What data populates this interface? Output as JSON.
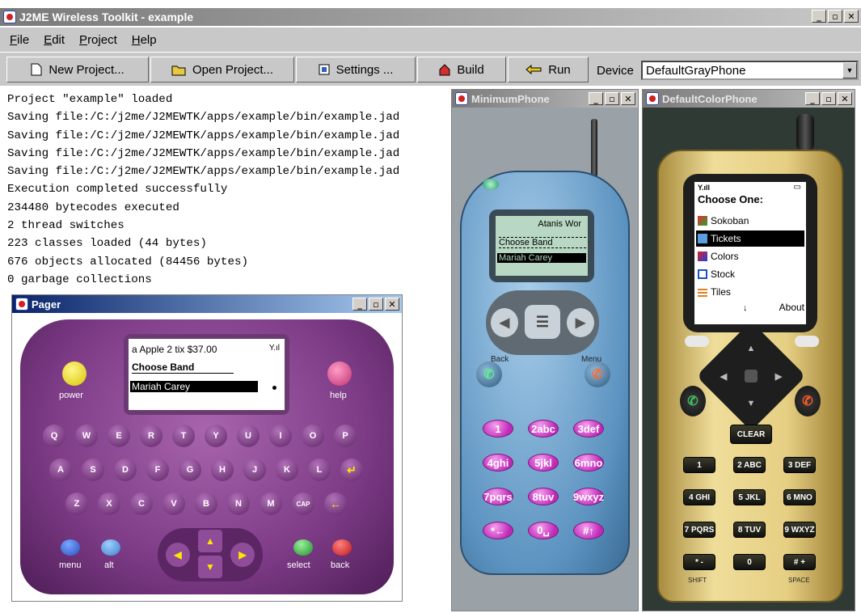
{
  "window": {
    "title": "J2ME Wireless Toolkit - example",
    "controls": [
      "_",
      "▫",
      "✕"
    ]
  },
  "menu": {
    "items": [
      "File",
      "Edit",
      "Project",
      "Help"
    ]
  },
  "toolbar": {
    "new_project": "New Project...",
    "open_project": "Open Project...",
    "settings": "Settings ...",
    "build": "Build",
    "run": "Run",
    "device_label": "Device",
    "device_value": "DefaultGrayPhone"
  },
  "console": {
    "lines": [
      "Project \"example\" loaded",
      "Saving file:/C:/j2me/J2MEWTK/apps/example/bin/example.jad",
      "Saving file:/C:/j2me/J2MEWTK/apps/example/bin/example.jad",
      "Saving file:/C:/j2me/J2MEWTK/apps/example/bin/example.jad",
      "Saving file:/C:/j2me/J2MEWTK/apps/example/bin/example.jad",
      "Execution completed successfully",
      "234480 bytecodes executed",
      "2 thread switches",
      "223 classes loaded (44 bytes)",
      "676 objects allocated (84456 bytes)",
      "0 garbage collections"
    ]
  },
  "pager": {
    "title": "Pager",
    "screen": {
      "line1": "a Apple 2 tix $37.00",
      "line2": "Choose Band",
      "line3": "Mariah Carey",
      "signal": "Y.ıl"
    },
    "buttons": {
      "power": "power",
      "help": "help",
      "menu": "menu",
      "alt": "alt",
      "select": "select",
      "back": "back",
      "cap": "CAP"
    },
    "rows": [
      [
        "Q",
        "W",
        "E",
        "R",
        "T",
        "Y",
        "U",
        "I",
        "O",
        "P"
      ],
      [
        "A",
        "S",
        "D",
        "F",
        "G",
        "H",
        "J",
        "K",
        "L"
      ],
      [
        "Z",
        "X",
        "C",
        "V",
        "B",
        "N",
        "M"
      ]
    ]
  },
  "minimum_phone": {
    "title": "MinimumPhone",
    "screen": {
      "top": "Atanis Wor",
      "line2": "Choose Band",
      "line3": "Mariah Carey"
    },
    "softkeys": {
      "left": "Back",
      "right": "Menu"
    },
    "keys": [
      "1",
      "2abc",
      "3def",
      "4ghi",
      "5jkl",
      "6mno",
      "7pqrs",
      "8tuv",
      "9wxyz",
      "*←",
      "0␣",
      "#↑"
    ]
  },
  "color_phone": {
    "title": "DefaultColorPhone",
    "screen": {
      "signal": "Y.ıll",
      "battery": "▭",
      "header": "Choose One:",
      "items": [
        "Sokoban",
        "Tickets",
        "Colors",
        "Stock",
        "Tiles"
      ],
      "selected": "Tickets",
      "softkey": "About",
      "arrow": "↓"
    },
    "clear": "CLEAR",
    "keys": [
      "1",
      "2 ABC",
      "3 DEF",
      "4 GHI",
      "5 JKL",
      "6 MNO",
      "7 PQRS",
      "8 TUV",
      "9 WXYZ",
      "* -",
      "0",
      "# +"
    ],
    "bottom_labels": {
      "left": "SHIFT",
      "right": "SPACE"
    }
  },
  "colors": {
    "titlebar": "#0a246a",
    "pager_body": "#7d3b86",
    "phone_body": "#6a9ec8",
    "key_pink": "#d247c7",
    "gold": "#d9c27a",
    "lcd": "#b8d8c4"
  }
}
